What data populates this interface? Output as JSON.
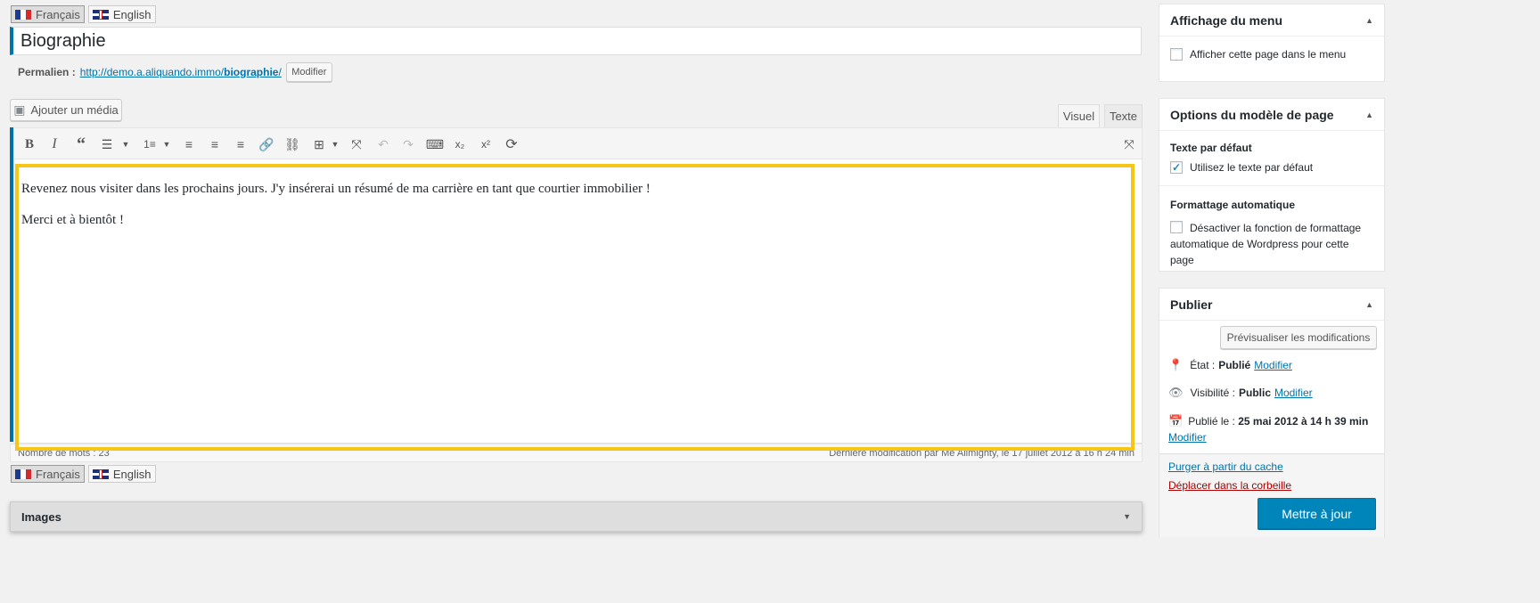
{
  "languages": {
    "fr": "Français",
    "en": "English"
  },
  "post_title": "Biographie",
  "permalink": {
    "label": "Permalien :",
    "url_base": "http://demo.a.aliquando.immo/",
    "url_slug": "biographie",
    "url_trail": "/",
    "edit_label": "Modifier"
  },
  "add_media_label": "Ajouter un média",
  "editor_tabs": {
    "visual": "Visuel",
    "text": "Texte"
  },
  "toolbar_icons": [
    "bold-icon",
    "italic-icon",
    "blockquote-icon",
    "bullet-list-icon",
    "numbered-list-icon",
    "align-left-icon",
    "align-center-icon",
    "align-right-icon",
    "link-icon",
    "unlink-icon",
    "table-icon",
    "fullscreen-icon",
    "undo-icon",
    "redo-icon",
    "keyboard-icon",
    "subscript-icon",
    "superscript-icon",
    "refresh-icon",
    "distraction-free-icon"
  ],
  "content": {
    "paragraph1": "Revenez nous visiter dans les prochains jours. J'y insérerai un résumé de ma carrière en tant que courtier immobilier !",
    "paragraph2": "Merci et à bientôt !"
  },
  "status_bar": {
    "word_count": "Nombre de mots : 23",
    "last_modified": "Dernière modification par Me Allmighty, le 17 juillet 2012 à 16 h 24 min"
  },
  "images_box": {
    "title": "Images"
  },
  "menu_panel": {
    "title": "Affichage du menu",
    "show_in_menu": "Afficher cette page dans le menu"
  },
  "template_panel": {
    "title": "Options du modèle de page",
    "default_text_heading": "Texte par défaut",
    "default_text_option": "Utilisez le texte par défaut",
    "autoformat_heading": "Formattage automatique",
    "autoformat_option": "Désactiver la fonction de formattage automatique de Wordpress pour cette page"
  },
  "publish_panel": {
    "title": "Publier",
    "preview_button": "Prévisualiser les modifications",
    "status_label": "État :",
    "status_value": "Publié",
    "visibility_label": "Visibilité :",
    "visibility_value": "Public",
    "published_label": "Publié le :",
    "published_value": "25 mai 2012 à 14 h 39 min",
    "edit_link": "Modifier",
    "purge_cache": "Purger à partir du cache",
    "trash": "Déplacer dans la corbeille",
    "update_button": "Mettre à jour"
  },
  "colors": {
    "accent": "#0073aa",
    "highlight": "#f5c518",
    "trash": "#a00",
    "update": "#0085ba"
  }
}
